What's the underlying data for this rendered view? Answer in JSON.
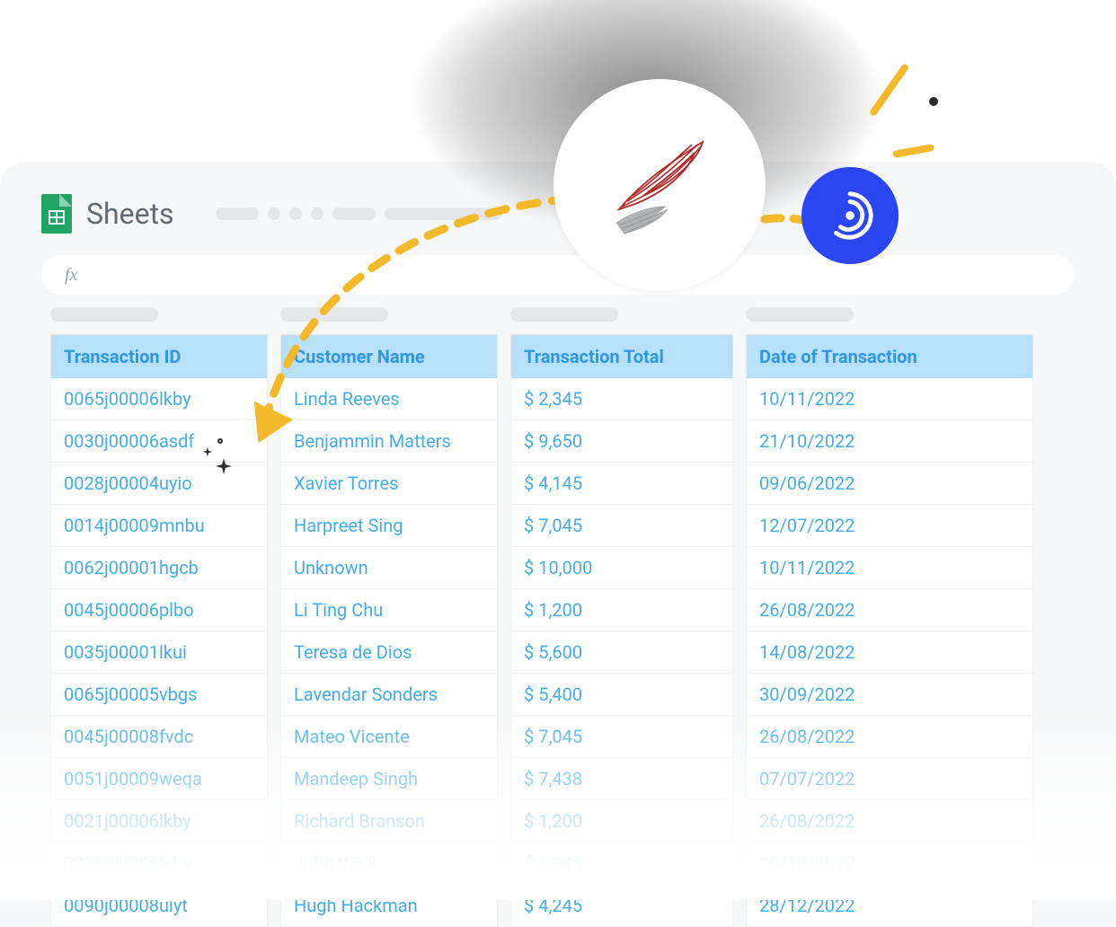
{
  "app": {
    "name": "Sheets"
  },
  "formula_bar": {
    "fx_label": "fx"
  },
  "icons": {
    "sql_server": "sql-server-logo",
    "connector": "connector-radar-logo"
  },
  "table": {
    "headers": [
      "Transaction ID",
      "Customer Name",
      "Transaction Total",
      "Date of Transaction"
    ],
    "rows": [
      {
        "id": "0065j00006lkby",
        "name": "Linda Reeves",
        "total": "$ 2,345",
        "date": "10/11/2022"
      },
      {
        "id": "0030j00006asdf",
        "name": "Benjammin Matters",
        "total": "$ 9,650",
        "date": "21/10/2022"
      },
      {
        "id": "0028j00004uyio",
        "name": "Xavier Torres",
        "total": "$ 4,145",
        "date": "09/06/2022"
      },
      {
        "id": "0014j00009mnbu",
        "name": "Harpreet Sing",
        "total": "$ 7,045",
        "date": "12/07/2022"
      },
      {
        "id": "0062j00001hgcb",
        "name": "Unknown",
        "total": "$ 10,000",
        "date": "10/11/2022"
      },
      {
        "id": "0045j00006plbo",
        "name": "Li Ting Chu",
        "total": "$ 1,200",
        "date": "26/08/2022"
      },
      {
        "id": "0035j00001lkui",
        "name": "Teresa de Dios",
        "total": "$ 5,600",
        "date": "14/08/2022"
      },
      {
        "id": "0065j00005vbgs",
        "name": "Lavendar Sonders",
        "total": "$ 5,400",
        "date": "30/09/2022"
      },
      {
        "id": "0045j00008fvdc",
        "name": "Mateo Vicente",
        "total": "$ 7,045",
        "date": "26/08/2022"
      },
      {
        "id": "0051j00009weqa",
        "name": "Mandeep Singh",
        "total": "$ 7,438",
        "date": "07/07/2022"
      },
      {
        "id": "0021j00006lkby",
        "name": "Richard Branson",
        "total": "$ 1,200",
        "date": "26/08/2022"
      },
      {
        "id": "0038j00006lkby",
        "name": "John Wick",
        "total": "$ 8,945",
        "date": "30/10/2022"
      },
      {
        "id": "0090j00008uiyt",
        "name": "Hugh Hackman",
        "total": "$ 4,245",
        "date": "28/12/2022"
      }
    ]
  }
}
